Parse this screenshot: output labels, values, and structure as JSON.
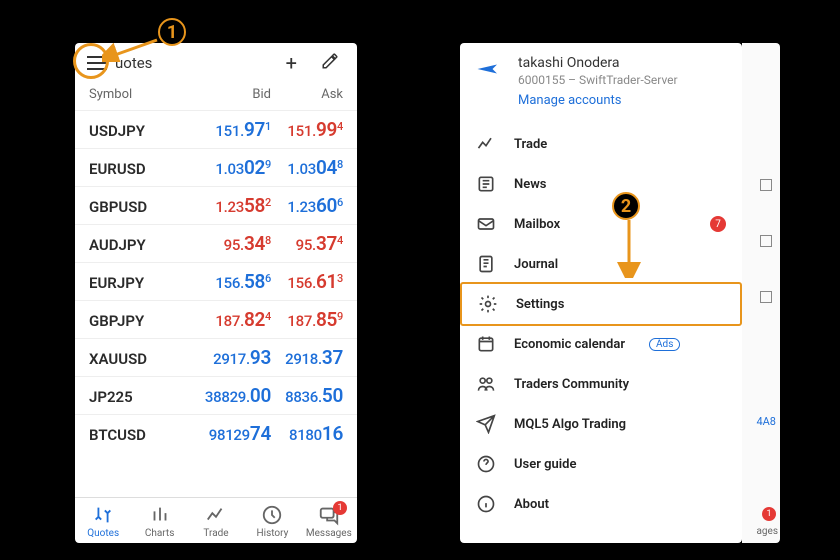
{
  "annotations": {
    "step1": "1",
    "step2": "2"
  },
  "left": {
    "title": "uotes",
    "columns": {
      "symbol": "Symbol",
      "bid": "Bid",
      "ask": "Ask"
    },
    "rows": [
      {
        "sym": "USDJPY",
        "bid_pre": "151.",
        "bid_big": "97",
        "bid_sup": "1",
        "bid_color": "blue",
        "ask_pre": "151.",
        "ask_big": "99",
        "ask_sup": "4",
        "ask_color": "red"
      },
      {
        "sym": "EURUSD",
        "bid_pre": "1.03",
        "bid_big": "02",
        "bid_sup": "9",
        "bid_color": "blue",
        "ask_pre": "1.03",
        "ask_big": "04",
        "ask_sup": "8",
        "ask_color": "blue"
      },
      {
        "sym": "GBPUSD",
        "bid_pre": "1.23",
        "bid_big": "58",
        "bid_sup": "2",
        "bid_color": "red",
        "ask_pre": "1.23",
        "ask_big": "60",
        "ask_sup": "6",
        "ask_color": "blue"
      },
      {
        "sym": "AUDJPY",
        "bid_pre": "95.",
        "bid_big": "34",
        "bid_sup": "8",
        "bid_color": "red",
        "ask_pre": "95.",
        "ask_big": "37",
        "ask_sup": "4",
        "ask_color": "red"
      },
      {
        "sym": "EURJPY",
        "bid_pre": "156.",
        "bid_big": "58",
        "bid_sup": "6",
        "bid_color": "blue",
        "ask_pre": "156.",
        "ask_big": "61",
        "ask_sup": "3",
        "ask_color": "red"
      },
      {
        "sym": "GBPJPY",
        "bid_pre": "187.",
        "bid_big": "82",
        "bid_sup": "4",
        "bid_color": "red",
        "ask_pre": "187.",
        "ask_big": "85",
        "ask_sup": "9",
        "ask_color": "red"
      },
      {
        "sym": "XAUUSD",
        "bid_pre": "2917.",
        "bid_big": "93",
        "bid_sup": "",
        "bid_color": "blue",
        "ask_pre": "2918.",
        "ask_big": "37",
        "ask_sup": "",
        "ask_color": "blue"
      },
      {
        "sym": "JP225",
        "bid_pre": "38829.",
        "bid_big": "00",
        "bid_sup": "",
        "bid_color": "blue",
        "ask_pre": "8836.",
        "ask_big": "50",
        "ask_sup": "",
        "ask_color": "blue"
      },
      {
        "sym": "BTCUSD",
        "bid_pre": "98129",
        "bid_big": "74",
        "bid_sup": "",
        "bid_color": "blue",
        "ask_pre": "8180",
        "ask_big": "16",
        "ask_sup": "",
        "ask_color": "blue"
      }
    ],
    "tabs": {
      "quotes": "Quotes",
      "charts": "Charts",
      "trade": "Trade",
      "history": "History",
      "messages": "Messages",
      "messages_badge": "1"
    }
  },
  "right": {
    "profile": {
      "name": "takashi Onodera",
      "sub": "6000155 – SwiftTrader-Server",
      "manage": "Manage accounts"
    },
    "menu": {
      "trade": "Trade",
      "news": "News",
      "mailbox": "Mailbox",
      "mailbox_badge": "7",
      "journal": "Journal",
      "settings": "Settings",
      "economic": "Economic calendar",
      "ads": "Ads",
      "community": "Traders Community",
      "algo": "MQL5 Algo Trading",
      "guide": "User guide",
      "about": "About"
    },
    "peek_label": "ages",
    "peek_badge": "1",
    "peek_code": "4A8"
  }
}
